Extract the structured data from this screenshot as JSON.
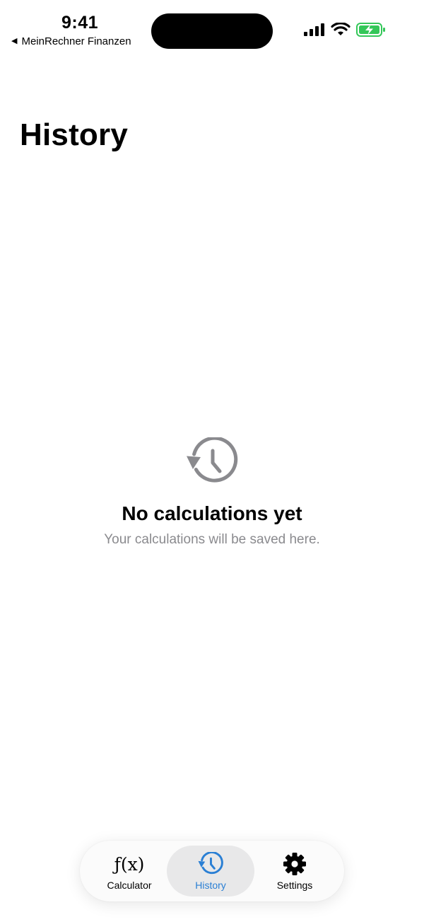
{
  "status_bar": {
    "time": "9:41",
    "back_app_label": "MeinRechner Finanzen",
    "icons": [
      "signal-icon",
      "wifi-icon",
      "battery-charging-icon"
    ],
    "battery_color": "#34c759"
  },
  "header": {
    "title": "History"
  },
  "empty_state": {
    "icon": "history-icon",
    "title": "No calculations yet",
    "subtitle": "Your calculations will be saved here."
  },
  "tab_bar": {
    "tabs": [
      {
        "id": "calculator",
        "label": "Calculator",
        "icon": "fx-icon",
        "active": false
      },
      {
        "id": "history",
        "label": "History",
        "icon": "history-icon",
        "active": true
      },
      {
        "id": "settings",
        "label": "Settings",
        "icon": "gear-icon",
        "active": false
      }
    ],
    "fx_symbol": "ƒ(x)",
    "active_color": "#2a7fd4"
  }
}
